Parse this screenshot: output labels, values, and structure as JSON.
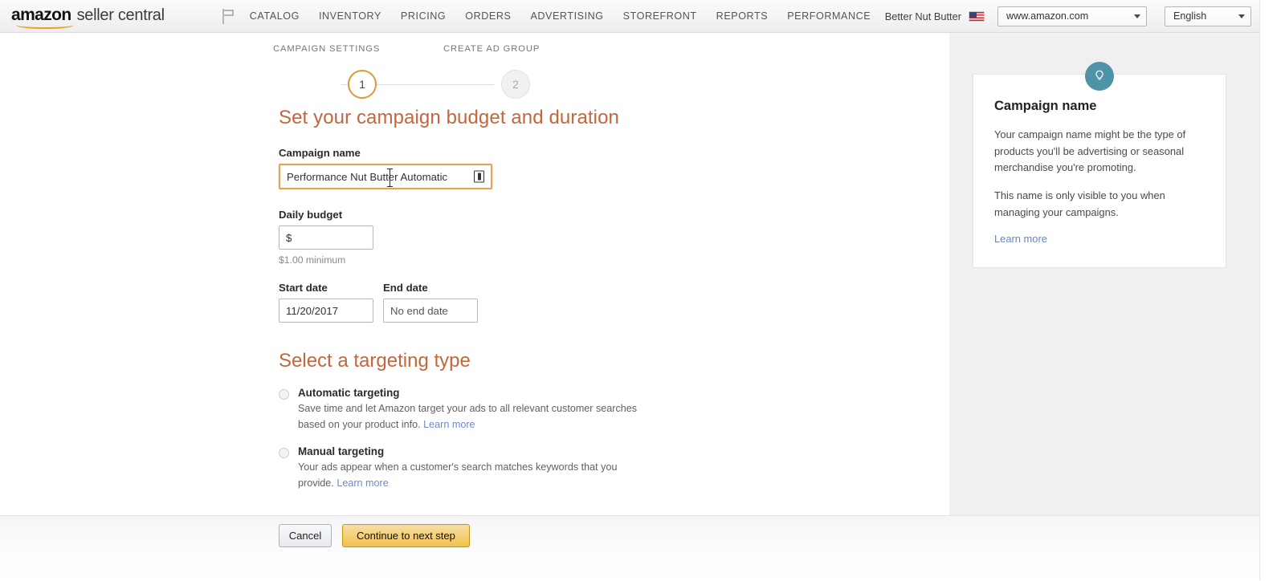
{
  "topnav": {
    "logo_primary": "amazon",
    "logo_secondary": "seller central",
    "flag_icon": "flag-icon",
    "links": [
      "CATALOG",
      "INVENTORY",
      "PRICING",
      "ORDERS",
      "ADVERTISING",
      "STOREFRONT",
      "REPORTS",
      "PERFORMANCE"
    ],
    "merchant_name": "Better Nut Butter",
    "country_flag_icon": "us-flag-icon",
    "marketplace_selected": "www.amazon.com",
    "language_selected": "English"
  },
  "stepper": {
    "steps": [
      {
        "label": "CAMPAIGN SETTINGS",
        "number": "1",
        "state": "active"
      },
      {
        "label": "CREATE AD GROUP",
        "number": "2",
        "state": "inactive"
      }
    ]
  },
  "form": {
    "budget_section_title": "Set your campaign budget and duration",
    "campaign_name_label": "Campaign name",
    "campaign_name_value": "Performance Nut Butter Automatic",
    "autofill_icon": "autofill-icon",
    "daily_budget_label": "Daily budget",
    "daily_budget_value": "$",
    "daily_budget_helper": "$1.00 minimum",
    "start_date_label": "Start date",
    "start_date_value": "11/20/2017",
    "end_date_label": "End date",
    "end_date_value": "No end date",
    "targeting_section_title": "Select a targeting type",
    "targeting_options": [
      {
        "title": "Automatic targeting",
        "description": "Save time and let Amazon target your ads to all relevant customer searches based on your product info.",
        "link": "Learn more",
        "selected": false
      },
      {
        "title": "Manual targeting",
        "description": "Your ads appear when a customer's search matches keywords that you provide.",
        "link": "Learn more",
        "selected": false
      }
    ]
  },
  "help_panel": {
    "badge_icon": "lightbulb-icon",
    "title": "Campaign name",
    "paragraph_1": "Your campaign name might be the type of products you'll be advertising or seasonal merchandise you're promoting.",
    "paragraph_2": "This name is only visible to you when managing your campaigns.",
    "link": "Learn more"
  },
  "footer": {
    "cancel_label": "Cancel",
    "continue_label": "Continue to next step"
  },
  "colors": {
    "brand_orange": "#c4663c",
    "accent_gold": "#d99a36",
    "primary_button": "#f0c14b",
    "link_blue": "#6a8dc6",
    "help_badge_teal": "#4e93a8"
  }
}
